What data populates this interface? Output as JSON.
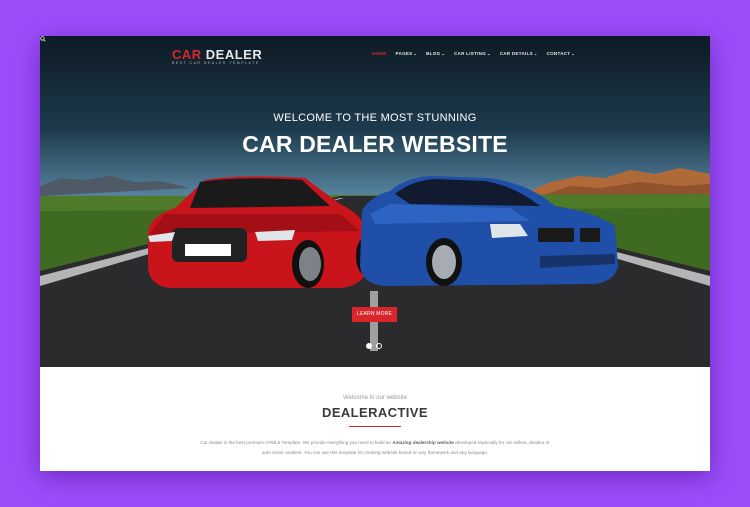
{
  "brand": {
    "logo_part1": "CAR",
    "logo_part2": " DEALER",
    "tagline": "BEST CAR DEALER TEMPLATE"
  },
  "nav": {
    "items": [
      {
        "label": "HOME",
        "active": true,
        "dropdown": false
      },
      {
        "label": "PAGES",
        "active": false,
        "dropdown": true
      },
      {
        "label": "BLOG",
        "active": false,
        "dropdown": true
      },
      {
        "label": "CAR LISTING",
        "active": false,
        "dropdown": true
      },
      {
        "label": "CAR DETAILS",
        "active": false,
        "dropdown": true
      },
      {
        "label": "CONTACT",
        "active": false,
        "dropdown": true
      }
    ],
    "chevron": "⌄",
    "search_icon": "search-icon"
  },
  "hero": {
    "subtitle": "WELCOME TO THE MOST STUNNING",
    "title": "CAR DEALER WEBSITE",
    "button_label": "LEARN MORE",
    "slides": 2,
    "active_slide": 1
  },
  "intro": {
    "kicker": "Welcome to our website",
    "title": "DEALERACTIVE",
    "text_before": "Car Dealer is the best premium HTML5 Template. We provide everything you need to build an ",
    "text_emphasis": "Amazing dealership website",
    "text_after": " developed especially for car sellers, dealers or auto motor retailers. You can use this template for creating website based on any framework and any language."
  },
  "colors": {
    "accent": "#d9262b",
    "page_bg": "#9b4dfa",
    "red_car": "#c9141c",
    "blue_car": "#1f4fa8"
  }
}
